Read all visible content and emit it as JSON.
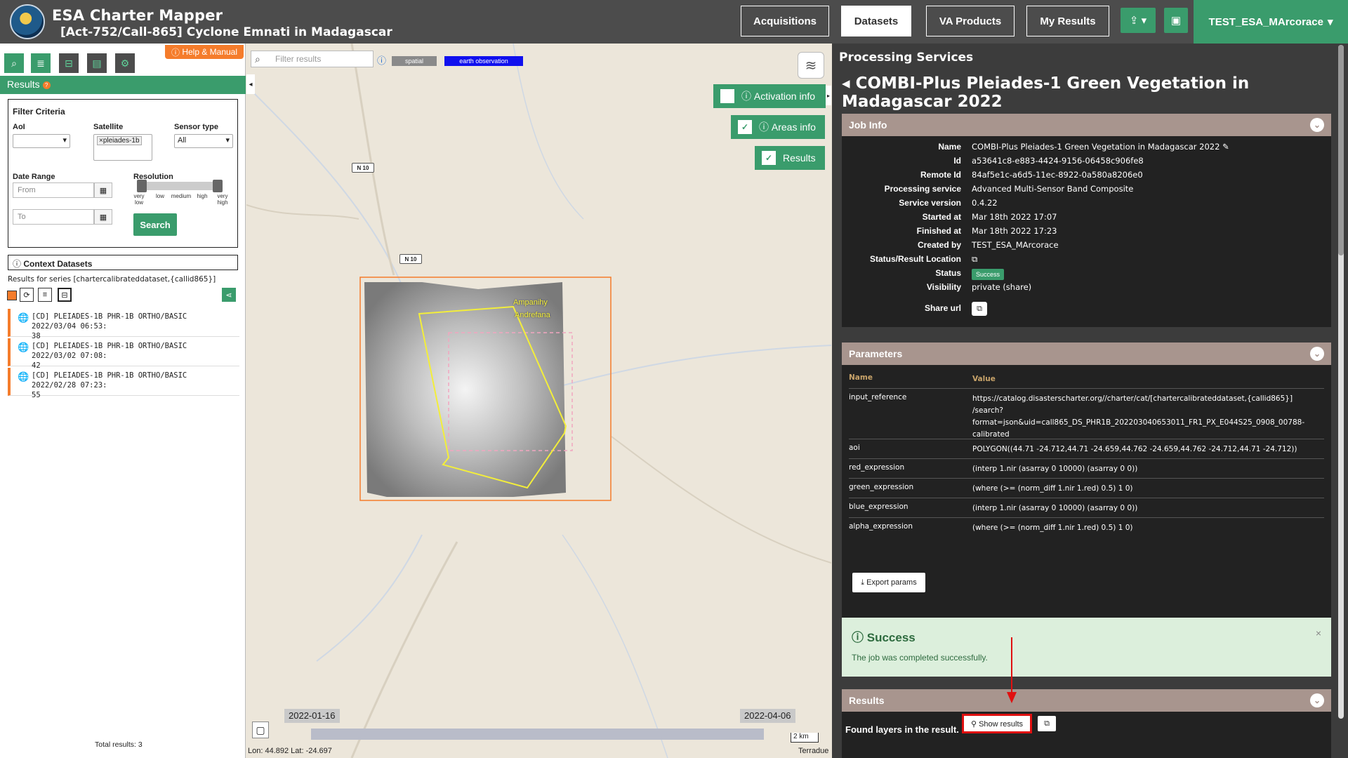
{
  "header": {
    "app_title": "ESA Charter Mapper",
    "activation": "[Act-752/Call-865] Cyclone Emnati in Madagascar",
    "nav": [
      "Acquisitions",
      "Datasets",
      "VA Products",
      "My Results"
    ],
    "active_nav": "Datasets",
    "user": "TEST_ESA_MArcorace",
    "user_caret": "▾",
    "upload_icon": "⇪ ▾",
    "briefcase_icon": "▣"
  },
  "left": {
    "help_label": "Help & Manual",
    "help_icon": "ⓘ",
    "results_title": "Results",
    "results_help": "?",
    "tools": [
      "⌕",
      "≣",
      "⊟",
      "▤",
      "⚙"
    ],
    "filter": {
      "title": "Filter Criteria",
      "aoi_label": "AoI",
      "satellite_label": "Satellite",
      "satellite_tag": "×pleiades-1b",
      "sensor_label": "Sensor type",
      "sensor_value": "All",
      "daterange_label": "Date Range",
      "from_placeholder": "From",
      "to_placeholder": "To",
      "resolution_label": "Resolution",
      "res_ticks": [
        "very low",
        "low",
        "medium",
        "high",
        "very high"
      ],
      "search_label": "Search",
      "calendar_icon": "▦",
      "caret": "▾"
    },
    "context": {
      "title": "Context Datasets",
      "icon": "ⓘ",
      "series": "Results for series [chartercalibrateddataset,{callid865}]",
      "btn_icons": [
        "",
        "⟳",
        "≡",
        "⊟"
      ],
      "share_icon": "⋖"
    },
    "items": [
      {
        "line1": "[CD] PLEIADES-1B PHR-1B ORTHO/BASIC 2022/03/04 06:53:",
        "line2": "38"
      },
      {
        "line1": "[CD] PLEIADES-1B PHR-1B ORTHO/BASIC 2022/03/02 07:08:",
        "line2": "42"
      },
      {
        "line1": "[CD] PLEIADES-1B PHR-1B ORTHO/BASIC 2022/02/28 07:23:",
        "line2": "55"
      }
    ],
    "globe_icon": "🌐",
    "total": "Total results: 3"
  },
  "map": {
    "filter_placeholder": "Filter results",
    "search_icon": "⌕",
    "info_icon": "ⓘ",
    "tags": [
      "spatial",
      "earth observation"
    ],
    "tag_colors": [
      "#8a8a8a",
      "#1010ee"
    ],
    "layers_icon": "≋",
    "collapse_icon": "◂",
    "expand_icon": "▸",
    "buttons": [
      {
        "label": "Activation info",
        "checked": false,
        "icon": "ⓘ"
      },
      {
        "label": "Areas info",
        "checked": true,
        "icon": "ⓘ"
      },
      {
        "label": "Results",
        "checked": true,
        "icon": ""
      }
    ],
    "check_mark": "✓",
    "road_labels": [
      "N 10",
      "N 10"
    ],
    "place_label_1": "Ampanihy",
    "place_label_2": "Andrefana",
    "date_start": "2022-01-16",
    "date_end": "2022-04-06",
    "timeline_icon": "▢",
    "coords": "Lon: 44.892 Lat: -24.697",
    "scale": "2 km",
    "attribution": "Terradue"
  },
  "panel": {
    "title": "Processing Services",
    "back_icon": "◂",
    "job_title": "COMBI-Plus Pleiades-1 Green Vegetation in Madagascar 2022",
    "jobinfo_title": "Job Info",
    "chevron_icon": "⌄",
    "fields": [
      {
        "k": "Name",
        "v": "COMBI-Plus Pleiades-1 Green Vegetation in Madagascar 2022 ✎"
      },
      {
        "k": "Id",
        "v": "a53641c8-e883-4424-9156-06458c906fe8"
      },
      {
        "k": "Remote Id",
        "v": "84af5e1c-a6d5-11ec-8922-0a580a8206e0"
      },
      {
        "k": "Processing service",
        "v": "Advanced Multi-Sensor Band Composite"
      },
      {
        "k": "Service version",
        "v": "0.4.22"
      },
      {
        "k": "Started at",
        "v": "Mar 18th 2022 17:07"
      },
      {
        "k": "Finished at",
        "v": "Mar 18th 2022 17:23"
      },
      {
        "k": "Created by",
        "v": "TEST_ESA_MArcorace"
      },
      {
        "k": "Status/Result Location",
        "v": "⧉"
      },
      {
        "k": "Status",
        "v": ""
      },
      {
        "k": "Visibility",
        "v": "private (share)"
      },
      {
        "k": "Share url",
        "v": ""
      }
    ],
    "status_badge": "Success",
    "copy_icon": "⧉",
    "params_title": "Parameters",
    "params_header": [
      "Name",
      "Value"
    ],
    "params": [
      {
        "n": "input_reference",
        "v": "https://catalog.disasterscharter.org//charter/cat/[chartercalibrateddataset,{callid865}] /search?format=json&uid=call865_DS_PHR1B_202203040653011_FR1_PX_E044S25_0908_00788-calibrated"
      },
      {
        "n": "aoi",
        "v": "POLYGON((44.71 -24.712,44.71 -24.659,44.762 -24.659,44.762 -24.712,44.71 -24.712))"
      },
      {
        "n": "red_expression",
        "v": "(interp 1.nir (asarray 0 10000) (asarray 0 0))"
      },
      {
        "n": "green_expression",
        "v": "(where (>= (norm_diff 1.nir 1.red) 0.5) 1 0)"
      },
      {
        "n": "blue_expression",
        "v": "(interp 1.nir (asarray 0 10000) (asarray 0 0))"
      },
      {
        "n": "alpha_expression",
        "v": "(where (>= (norm_diff 1.nir 1.red) 0.5) 1 0)"
      }
    ],
    "export_label": "⤓ Export params",
    "success_title": "Success",
    "success_icon": "ⓘ",
    "success_msg": "The job was completed successfully.",
    "close_icon": "×",
    "results_title": "Results",
    "found_layers": "Found layers in the result.",
    "show_results": "⚲ Show results"
  }
}
